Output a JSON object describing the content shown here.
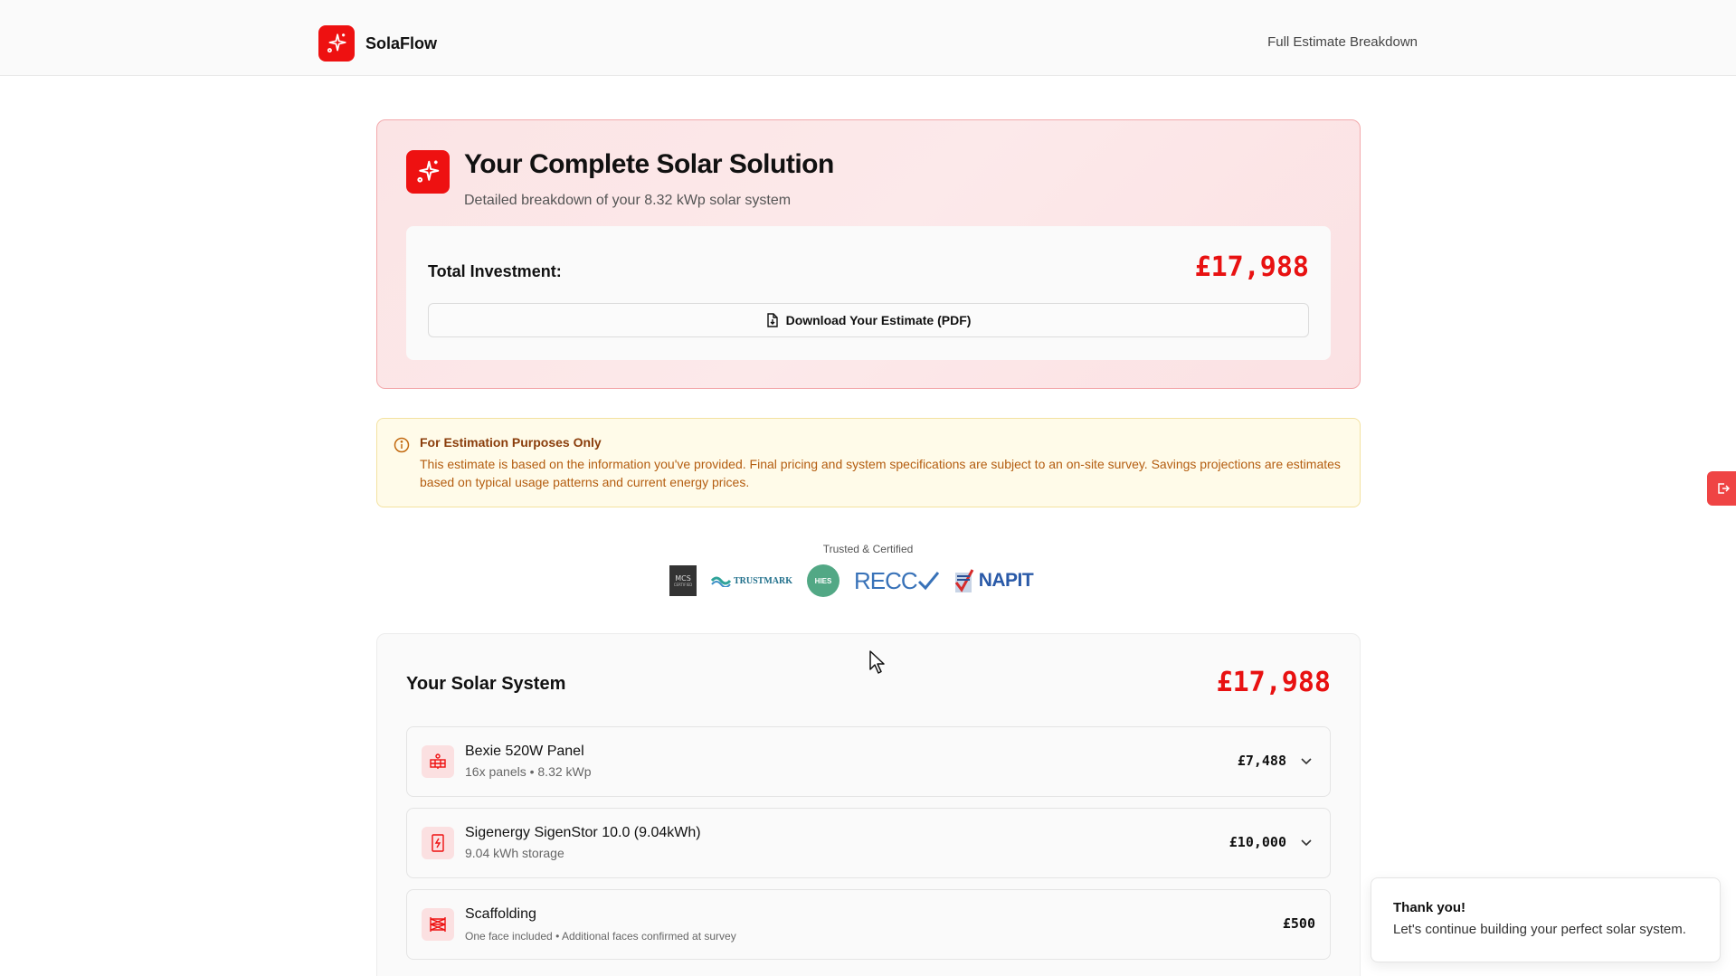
{
  "header": {
    "brand_name": "SolaFlow",
    "nav_link": "Full Estimate Breakdown",
    "logo_icon": "sparkles-icon"
  },
  "hero": {
    "title": "Your Complete Solar Solution",
    "subtitle": "Detailed breakdown of your 8.32 kWp solar system",
    "total_label": "Total Investment:",
    "total_value": "£17,988",
    "download_label": "Download Your Estimate (PDF)",
    "download_icon": "file-download-icon"
  },
  "notice": {
    "title": "For Estimation Purposes Only",
    "text": "This estimate is based on the information you've provided. Final pricing and system specifications are subject to an on-site survey. Savings projections are estimates based on typical usage patterns and current energy prices.",
    "icon": "info-icon"
  },
  "certifications": {
    "label": "Trusted & Certified",
    "logos": [
      {
        "name": "MCS",
        "text": "MCS",
        "sub": "CERTIFIED"
      },
      {
        "name": "TrustMark",
        "text": "TRUSTMARK"
      },
      {
        "name": "HIES",
        "text": "HIES"
      },
      {
        "name": "RECC",
        "text": "RECC"
      },
      {
        "name": "NAPIT",
        "text": "NAPIT"
      }
    ]
  },
  "system": {
    "title": "Your Solar System",
    "total": "£17,988",
    "items": [
      {
        "name": "Bexie 520W Panel",
        "sub": "16x panels • 8.32 kWp",
        "price": "£7,488",
        "icon": "solar-panel-icon",
        "expandable": true
      },
      {
        "name": "Sigenergy SigenStor 10.0 (9.04kWh)",
        "sub": "9.04 kWh storage",
        "price": "£10,000",
        "icon": "battery-icon",
        "expandable": true
      },
      {
        "name": "Scaffolding",
        "sub": "One face included • Additional faces confirmed at survey",
        "price": "£500",
        "icon": "scaffolding-icon",
        "expandable": false
      }
    ]
  },
  "toast": {
    "title": "Thank you!",
    "text": "Let's continue building your perfect solar system."
  },
  "colors": {
    "brand": "#ee1111",
    "price_red": "#e81111",
    "notice_bg": "#fffbe9",
    "notice_text": "#b45d10"
  }
}
